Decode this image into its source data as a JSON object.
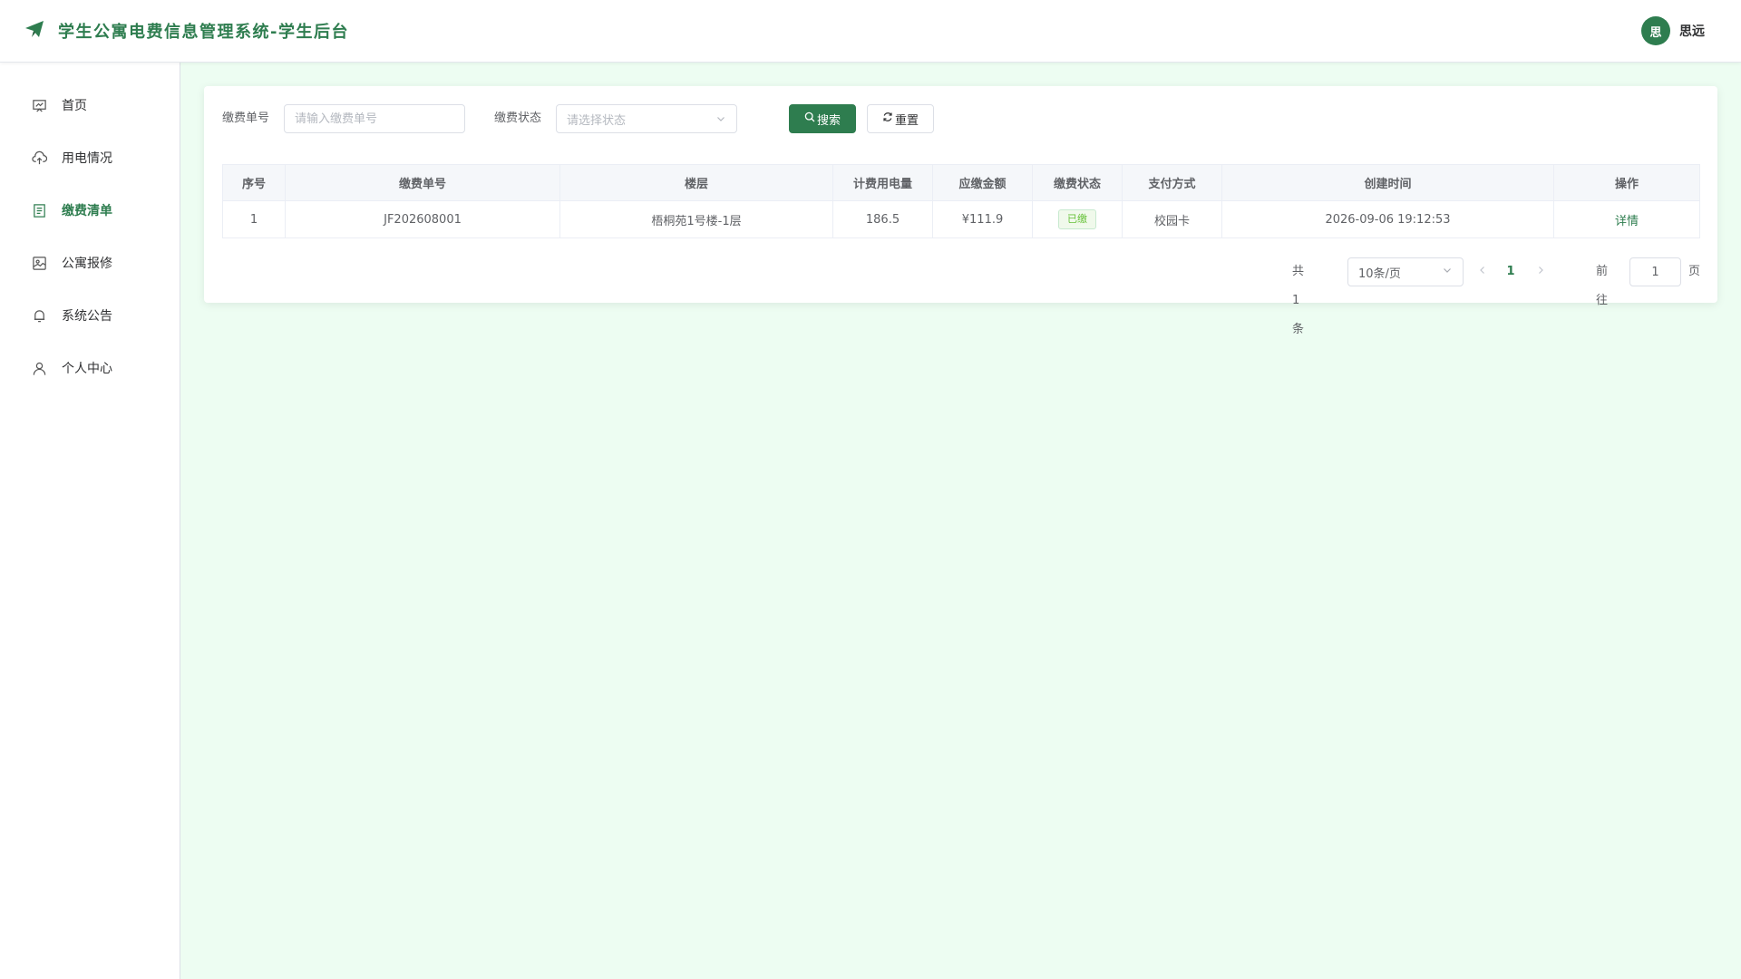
{
  "header": {
    "title": "学生公寓电费信息管理系统-学生后台",
    "user": {
      "avatar_text": "思",
      "name": "思远"
    }
  },
  "sidebar": {
    "items": [
      {
        "label": "首页",
        "icon": "dashboard-icon"
      },
      {
        "label": "用电情况",
        "icon": "cloud-upload-icon"
      },
      {
        "label": "缴费清单",
        "icon": "document-icon",
        "active": true
      },
      {
        "label": "公寓报修",
        "icon": "repair-picture-icon"
      },
      {
        "label": "系统公告",
        "icon": "bell-icon"
      },
      {
        "label": "个人中心",
        "icon": "user-icon"
      }
    ]
  },
  "search": {
    "bill_no_label": "缴费单号",
    "bill_no_placeholder": "请输入缴费单号",
    "status_label": "缴费状态",
    "status_placeholder": "请选择状态",
    "search_button": "搜索",
    "reset_button": "重置"
  },
  "table": {
    "columns": [
      "序号",
      "缴费单号",
      "楼层",
      "计费用电量",
      "应缴金额",
      "缴费状态",
      "支付方式",
      "创建时间",
      "操作"
    ],
    "rows": [
      {
        "index": "1",
        "bill_no": "JF202608001",
        "floor": "梧桐苑1号楼-1层",
        "usage": "186.5",
        "amount": "¥111.9",
        "status": "已缴",
        "payment": "校园卡",
        "created": "2026-09-06 19:12:53",
        "action": "详情"
      }
    ]
  },
  "pagination": {
    "total_text": "共 1 条",
    "page_size": "10条/页",
    "current_page": "1",
    "goto_label": "前往",
    "goto_value": "1",
    "page_suffix": "页"
  },
  "colors": {
    "primary": "#2e7d4f",
    "main_background": "#edfdf2",
    "success_tag": "#67c23a"
  }
}
